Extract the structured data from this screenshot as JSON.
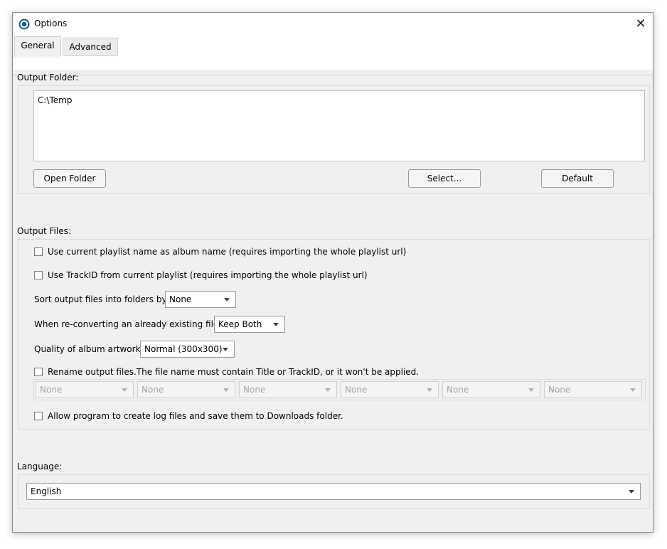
{
  "window": {
    "title": "Options",
    "close_glyph": "✕"
  },
  "tabs": [
    {
      "label": "General",
      "active": true
    },
    {
      "label": "Advanced",
      "active": false
    }
  ],
  "output_folder": {
    "label": "Output Folder:",
    "path": "C:\\Temp",
    "open_button": "Open Folder",
    "select_button": "Select...",
    "default_button": "Default"
  },
  "output_files": {
    "label": "Output Files:",
    "use_playlist_name": {
      "label": "Use current playlist name as album name (requires importing the whole playlist url)",
      "checked": false
    },
    "use_trackid": {
      "label": "Use TrackID from current playlist (requires importing the whole playlist url)",
      "checked": false
    },
    "sort_folders": {
      "label": "Sort output files into folders by:",
      "value": "None"
    },
    "reconvert": {
      "label": "When re-converting an already existing file:",
      "value": "Keep Both"
    },
    "artwork_quality": {
      "label": "Quality of album artwork:",
      "value": "Normal (300x300)"
    },
    "rename": {
      "label": "Rename output files.The file name must contain Title or TrackID, or it won't be applied.",
      "checked": false,
      "slots": [
        "None",
        "None",
        "None",
        "None",
        "None",
        "None"
      ]
    },
    "log_files": {
      "label": "Allow program to create log files and save them to Downloads folder.",
      "checked": false
    }
  },
  "language": {
    "label": "Language:",
    "value": "English"
  },
  "colors": {
    "window_bg": "#f0f0f0",
    "titlebar_bg": "#ffffff",
    "border": "#8a8a8a"
  }
}
